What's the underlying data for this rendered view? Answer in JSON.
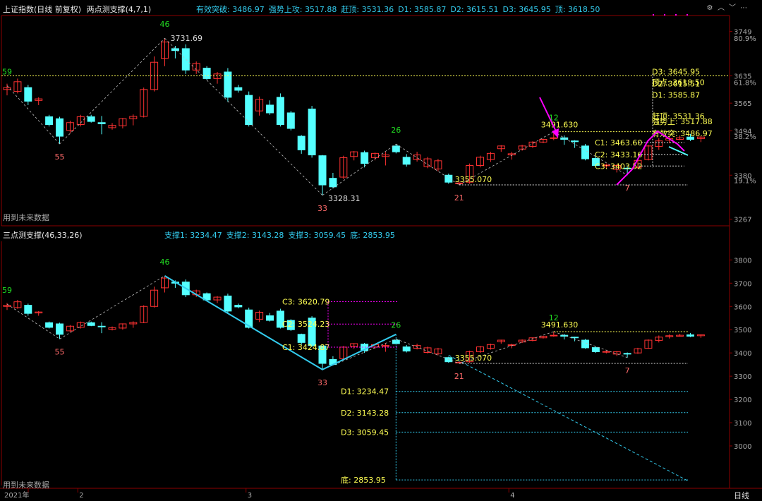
{
  "top_header": {
    "title": "上证指数(日线 前复权)",
    "indicator": "两点测支撑(4,7,1)",
    "values": [
      {
        "label": "有效突破:",
        "value": "3486.97"
      },
      {
        "label": "强势上攻:",
        "value": "3517.88"
      },
      {
        "label": "赶顶:",
        "value": "3531.36"
      },
      {
        "label": "D1:",
        "value": "3585.87"
      },
      {
        "label": "D2:",
        "value": "3615.51"
      },
      {
        "label": "D3:",
        "value": "3645.95"
      },
      {
        "label": "顶:",
        "value": "3618.50"
      }
    ]
  },
  "bottom_header": {
    "indicator": "三点测支撑(46,33,26)",
    "values": [
      {
        "label": "支撑1:",
        "value": "3234.47"
      },
      {
        "label": "支撑2:",
        "value": "3143.28"
      },
      {
        "label": "支撑3:",
        "value": "3059.45"
      },
      {
        "label": "底:",
        "value": "2853.95"
      }
    ]
  },
  "future_note": "用到未来数据",
  "period_label": "日线",
  "colors": {
    "up": "#ff3232",
    "down": "#54ffff",
    "yellow": "#ffff54",
    "magenta": "#ff00ff",
    "cyan": "#33ccee",
    "green": "#22dd22",
    "pink": "#ff6a6a",
    "grid": "#8b0000",
    "text": "#cccccc"
  },
  "chart_data": {
    "type": "candlestick",
    "x_axis": {
      "labels": [
        "2021年",
        "2",
        "3",
        "4"
      ]
    },
    "candles": [
      {
        "o": 3600,
        "h": 3615,
        "l": 3585,
        "c": 3605
      },
      {
        "o": 3595,
        "h": 3628,
        "l": 3590,
        "c": 3620
      },
      {
        "o": 3605,
        "h": 3612,
        "l": 3560,
        "c": 3570
      },
      {
        "o": 3572,
        "h": 3580,
        "l": 3560,
        "c": 3576
      },
      {
        "o": 3530,
        "h": 3535,
        "l": 3505,
        "c": 3510
      },
      {
        "o": 3525,
        "h": 3530,
        "l": 3460,
        "c": 3480
      },
      {
        "o": 3495,
        "h": 3520,
        "l": 3488,
        "c": 3515
      },
      {
        "o": 3510,
        "h": 3535,
        "l": 3505,
        "c": 3530
      },
      {
        "o": 3530,
        "h": 3535,
        "l": 3515,
        "c": 3518
      },
      {
        "o": 3515,
        "h": 3532,
        "l": 3485,
        "c": 3512
      },
      {
        "o": 3502,
        "h": 3514,
        "l": 3497,
        "c": 3508
      },
      {
        "o": 3507,
        "h": 3527,
        "l": 3500,
        "c": 3525
      },
      {
        "o": 3525,
        "h": 3536,
        "l": 3508,
        "c": 3531
      },
      {
        "o": 3531,
        "h": 3605,
        "l": 3528,
        "c": 3600
      },
      {
        "o": 3600,
        "h": 3685,
        "l": 3595,
        "c": 3670
      },
      {
        "o": 3680,
        "h": 3731.69,
        "l": 3660,
        "c": 3722
      },
      {
        "o": 3705,
        "h": 3712,
        "l": 3680,
        "c": 3700
      },
      {
        "o": 3705,
        "h": 3716,
        "l": 3640,
        "c": 3650
      },
      {
        "o": 3650,
        "h": 3672,
        "l": 3640,
        "c": 3667
      },
      {
        "o": 3655,
        "h": 3660,
        "l": 3625,
        "c": 3628
      },
      {
        "o": 3628,
        "h": 3645,
        "l": 3615,
        "c": 3640
      },
      {
        "o": 3645,
        "h": 3655,
        "l": 3568,
        "c": 3580
      },
      {
        "o": 3605,
        "h": 3612,
        "l": 3592,
        "c": 3598
      },
      {
        "o": 3585,
        "h": 3595,
        "l": 3505,
        "c": 3510
      },
      {
        "o": 3545,
        "h": 3582,
        "l": 3533,
        "c": 3575
      },
      {
        "o": 3560,
        "h": 3572,
        "l": 3535,
        "c": 3540
      },
      {
        "o": 3580,
        "h": 3590,
        "l": 3505,
        "c": 3510
      },
      {
        "o": 3540,
        "h": 3545,
        "l": 3495,
        "c": 3500
      },
      {
        "o": 3480,
        "h": 3483,
        "l": 3435,
        "c": 3445
      },
      {
        "o": 3550,
        "h": 3558,
        "l": 3425,
        "c": 3432
      },
      {
        "o": 3430,
        "h": 3432,
        "l": 3328.31,
        "c": 3355
      },
      {
        "o": 3372,
        "h": 3386,
        "l": 3346,
        "c": 3350
      },
      {
        "o": 3375,
        "h": 3430,
        "l": 3370,
        "c": 3425
      },
      {
        "o": 3428,
        "h": 3442,
        "l": 3418,
        "c": 3440
      },
      {
        "o": 3438,
        "h": 3443,
        "l": 3400,
        "c": 3410
      },
      {
        "o": 3425,
        "h": 3438,
        "l": 3418,
        "c": 3436
      },
      {
        "o": 3428,
        "h": 3440,
        "l": 3405,
        "c": 3432
      },
      {
        "o": 3455,
        "h": 3460,
        "l": 3436,
        "c": 3440
      },
      {
        "o": 3426,
        "h": 3434,
        "l": 3402,
        "c": 3408
      },
      {
        "o": 3420,
        "h": 3440,
        "l": 3415,
        "c": 3432
      },
      {
        "o": 3402,
        "h": 3427,
        "l": 3398,
        "c": 3422
      },
      {
        "o": 3396,
        "h": 3422,
        "l": 3390,
        "c": 3417
      },
      {
        "o": 3380,
        "h": 3384,
        "l": 3358,
        "c": 3362
      },
      {
        "o": 3359,
        "h": 3364,
        "l": 3355.07,
        "c": 3360
      },
      {
        "o": 3362,
        "h": 3410,
        "l": 3358,
        "c": 3405
      },
      {
        "o": 3405,
        "h": 3430,
        "l": 3400,
        "c": 3426
      },
      {
        "o": 3420,
        "h": 3440,
        "l": 3414,
        "c": 3436
      },
      {
        "o": 3448,
        "h": 3457,
        "l": 3440,
        "c": 3455
      },
      {
        "o": 3432,
        "h": 3440,
        "l": 3420,
        "c": 3435
      },
      {
        "o": 3447,
        "h": 3458,
        "l": 3443,
        "c": 3455
      },
      {
        "o": 3454,
        "h": 3467,
        "l": 3450,
        "c": 3465
      },
      {
        "o": 3465,
        "h": 3474,
        "l": 3462,
        "c": 3472
      },
      {
        "o": 3475,
        "h": 3491.63,
        "l": 3470,
        "c": 3476
      },
      {
        "o": 3476,
        "h": 3482,
        "l": 3458,
        "c": 3472
      },
      {
        "o": 3468,
        "h": 3470,
        "l": 3450,
        "c": 3466
      },
      {
        "o": 3455,
        "h": 3460,
        "l": 3418,
        "c": 3422
      },
      {
        "o": 3423,
        "h": 3428,
        "l": 3400,
        "c": 3405
      },
      {
        "o": 3406,
        "h": 3410,
        "l": 3398,
        "c": 3406
      },
      {
        "o": 3395,
        "h": 3408,
        "l": 3387,
        "c": 3405
      },
      {
        "o": 3398,
        "h": 3402,
        "l": 3380,
        "c": 3397
      },
      {
        "o": 3400,
        "h": 3422,
        "l": 3396,
        "c": 3418
      },
      {
        "o": 3420,
        "h": 3458,
        "l": 3418,
        "c": 3455
      },
      {
        "o": 3454,
        "h": 3475,
        "l": 3445,
        "c": 3468
      },
      {
        "o": 3470,
        "h": 3480,
        "l": 3462,
        "c": 3474
      },
      {
        "o": 3472,
        "h": 3482,
        "l": 3470,
        "c": 3476
      },
      {
        "o": 3478,
        "h": 3486,
        "l": 3468,
        "c": 3472
      },
      {
        "o": 3474,
        "h": 3480,
        "l": 3465,
        "c": 3478
      }
    ],
    "zigzag_pivots": [
      {
        "i": 0,
        "price": 3610,
        "label": "59"
      },
      {
        "i": 5,
        "price": 3460,
        "label": "55"
      },
      {
        "i": 15,
        "price": 3731.69,
        "label": "46"
      },
      {
        "i": 30,
        "price": 3328.31,
        "label": "33"
      },
      {
        "i": 37,
        "price": 3460,
        "label": "26"
      },
      {
        "i": 43,
        "price": 3355.07,
        "label": "21"
      },
      {
        "i": 52,
        "price": 3491.63,
        "label": "12"
      },
      {
        "i": 59,
        "price": 3380,
        "label": "7"
      }
    ],
    "top_panel": {
      "ylim": [
        3250,
        3790
      ],
      "y_ticks": [
        {
          "v": 3749,
          "t": "3749"
        },
        {
          "v": 3635,
          "t": "3635"
        },
        {
          "v": 3565,
          "t": "3565"
        },
        {
          "v": 3494,
          "t": "3494"
        },
        {
          "v": 3380,
          "t": "3380"
        },
        {
          "v": 3267,
          "t": "3267"
        }
      ],
      "y_pct": [
        {
          "v": 3731.69,
          "t": "80.9%"
        },
        {
          "v": 3618.5,
          "t": "61.8%"
        },
        {
          "v": 3480,
          "t": "38.2%"
        },
        {
          "v": 3367,
          "t": "19.1%"
        }
      ],
      "price_labels": [
        {
          "i": 15,
          "price": 3731.69,
          "t": "3731.69"
        },
        {
          "i": 30,
          "price": 3328.31,
          "t": "3328.31"
        },
        {
          "i": 52,
          "price": 3491.63,
          "t": "3491.630"
        },
        {
          "i": 43,
          "price": 3355.07,
          "t": "3355.070"
        }
      ],
      "c_levels": [
        {
          "price": 3463.6,
          "t": "C1: 3463.60"
        },
        {
          "price": 3433.16,
          "t": "C2: 3433.16"
        },
        {
          "price": 3403.52,
          "t": "C3: 3403.52"
        }
      ],
      "right_labels": [
        {
          "price": 3645.95,
          "t": "D3: 3645.95"
        },
        {
          "price": 3618.5,
          "t": "顶点: 3618.50"
        },
        {
          "price": 3615.51,
          "t": "D2: 3615.51"
        },
        {
          "price": 3585.87,
          "t": "D1: 3585.87"
        },
        {
          "price": 3531.36,
          "t": "赶顶: 3531.36"
        },
        {
          "price": 3517.88,
          "t": "强势上: 3517.88"
        },
        {
          "price": 3486.97,
          "t": "有效突: 3486.97"
        }
      ],
      "level_lines": [
        3635,
        3491.63,
        3355.07
      ]
    },
    "bottom_panel": {
      "ylim": [
        2830,
        3880
      ],
      "y_ticks": [
        {
          "v": 3800,
          "t": "3800"
        },
        {
          "v": 3700,
          "t": "3700"
        },
        {
          "v": 3600,
          "t": "3600"
        },
        {
          "v": 3500,
          "t": "3500"
        },
        {
          "v": 3400,
          "t": "3400"
        },
        {
          "v": 3300,
          "t": "3300"
        },
        {
          "v": 3200,
          "t": "3200"
        },
        {
          "v": 3100,
          "t": "3100"
        },
        {
          "v": 3000,
          "t": "3000"
        }
      ],
      "c_levels": [
        {
          "price": 3620.79,
          "t": "C3: 3620.79"
        },
        {
          "price": 3524.23,
          "t": "C2: 3524.23"
        },
        {
          "price": 3424.87,
          "t": "C1: 3424.87"
        }
      ],
      "d_levels": [
        {
          "price": 3234.47,
          "t": "D1: 3234.47"
        },
        {
          "price": 3143.28,
          "t": "D2: 3143.28"
        },
        {
          "price": 3059.45,
          "t": "D3: 3059.45"
        },
        {
          "price": 2853.95,
          "t": "底: 2853.95"
        }
      ],
      "price_labels": [
        {
          "i": 52,
          "price": 3491.63,
          "t": "3491.630"
        },
        {
          "i": 43,
          "price": 3355.07,
          "t": "3355.070"
        }
      ],
      "level_lines": [
        3491.63,
        3355.07
      ]
    }
  }
}
